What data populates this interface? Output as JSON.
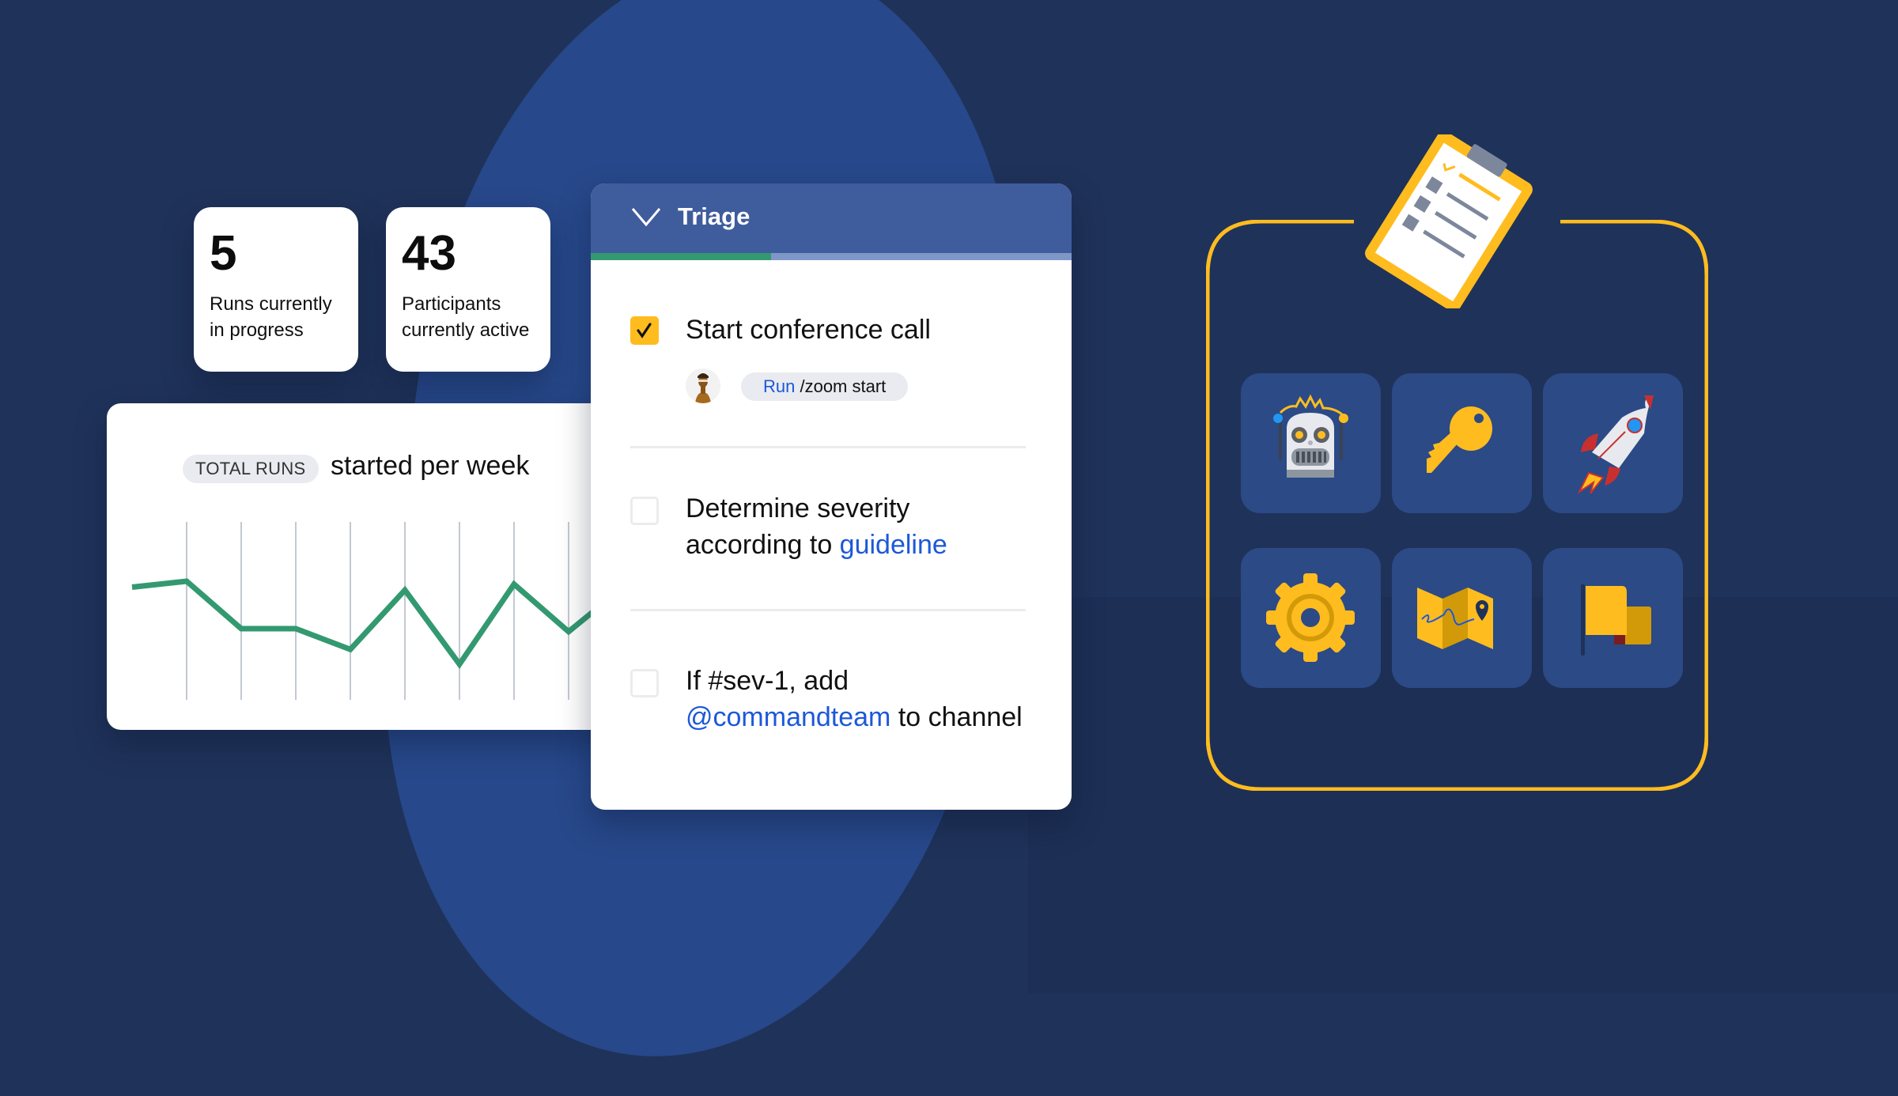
{
  "stats": [
    {
      "value": "5",
      "label_line1": "Runs currently",
      "label_line2": "in progress"
    },
    {
      "value": "43",
      "label_line1": "Participants",
      "label_line2": "currently active"
    }
  ],
  "chart": {
    "pill_label": "TOTAL RUNS",
    "title": "started per week"
  },
  "chart_data": {
    "type": "line",
    "title": "TOTAL RUNS started per week",
    "xlabel": "",
    "ylabel": "",
    "grid": "vertical",
    "legend": "none",
    "x": [
      0,
      1,
      2,
      3,
      4,
      5,
      6,
      7,
      8,
      9
    ],
    "series": [
      {
        "name": "Total runs started",
        "color": "#339970",
        "values": [
          6.8,
          7.0,
          5.4,
          5.4,
          4.7,
          6.7,
          4.2,
          6.9,
          5.3,
          6.8
        ]
      }
    ],
    "ylim": [
      3,
      9
    ]
  },
  "triage": {
    "title": "Triage",
    "progress_fraction": 0.375,
    "tasks": [
      {
        "checked": true,
        "text": "Start conference call",
        "avatar": "user-avatar",
        "command_prefix": "Run",
        "command": " /zoom start"
      },
      {
        "checked": false,
        "line1": "Determine severity",
        "line2_prefix": "according to ",
        "line2_link": "guideline"
      },
      {
        "checked": false,
        "line1": "If #sev-1, add",
        "line2_link": "@commandteam",
        "line2_suffix": " to channel"
      }
    ]
  },
  "icons": [
    "robot-icon",
    "key-icon",
    "rocket-icon",
    "gear-icon",
    "map-icon",
    "flag-icon"
  ],
  "colors": {
    "background": "#1f3259",
    "blob": "#27488a",
    "accent_yellow": "#ffbc1f",
    "progress_green": "#339970",
    "header_blue": "#3f5c9c",
    "link_blue": "#1c58d9",
    "tile_blue": "#2b4a86"
  }
}
